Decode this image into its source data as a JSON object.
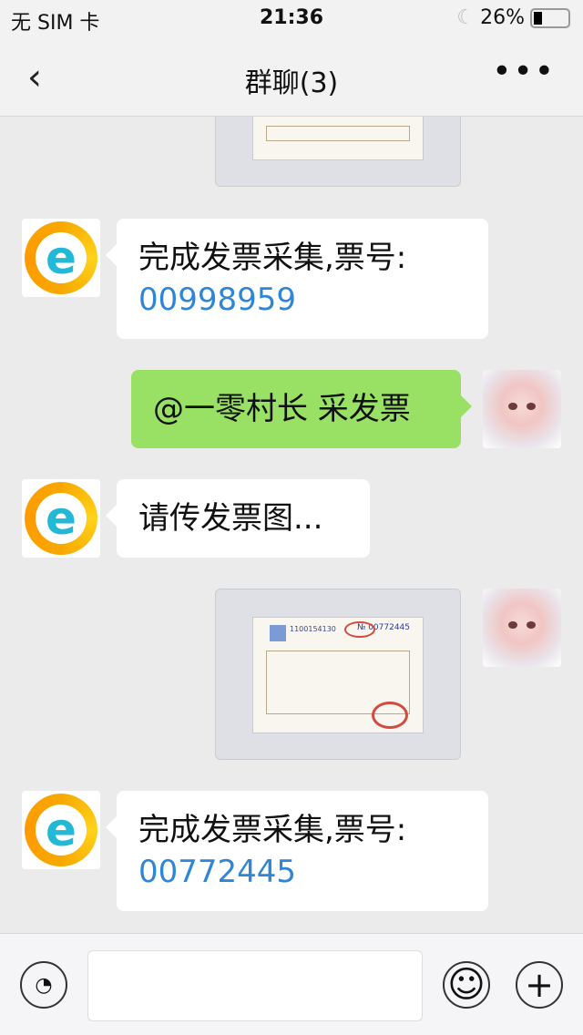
{
  "status_bar": {
    "carrier": "无 SIM 卡",
    "time": "21:36",
    "battery": "26%",
    "battery_level": 0.26
  },
  "nav": {
    "title": "群聊(3)",
    "back_icon": "‹",
    "more_icon": "•••"
  },
  "messages": [
    {
      "text": "完成发票采集,票号:",
      "number": "00998959"
    },
    {
      "text": "@一零村长 采发票"
    },
    {
      "text": "请传发票图..."
    },
    {
      "invoice_code": "1100154130",
      "invoice_no": "№ 00772445"
    },
    {
      "text": "完成发票采集,票号:",
      "number": "00772445"
    }
  ],
  "bottom": {
    "voice_icon": "◔",
    "emoji_icon": "☺",
    "plus_icon": "+"
  }
}
